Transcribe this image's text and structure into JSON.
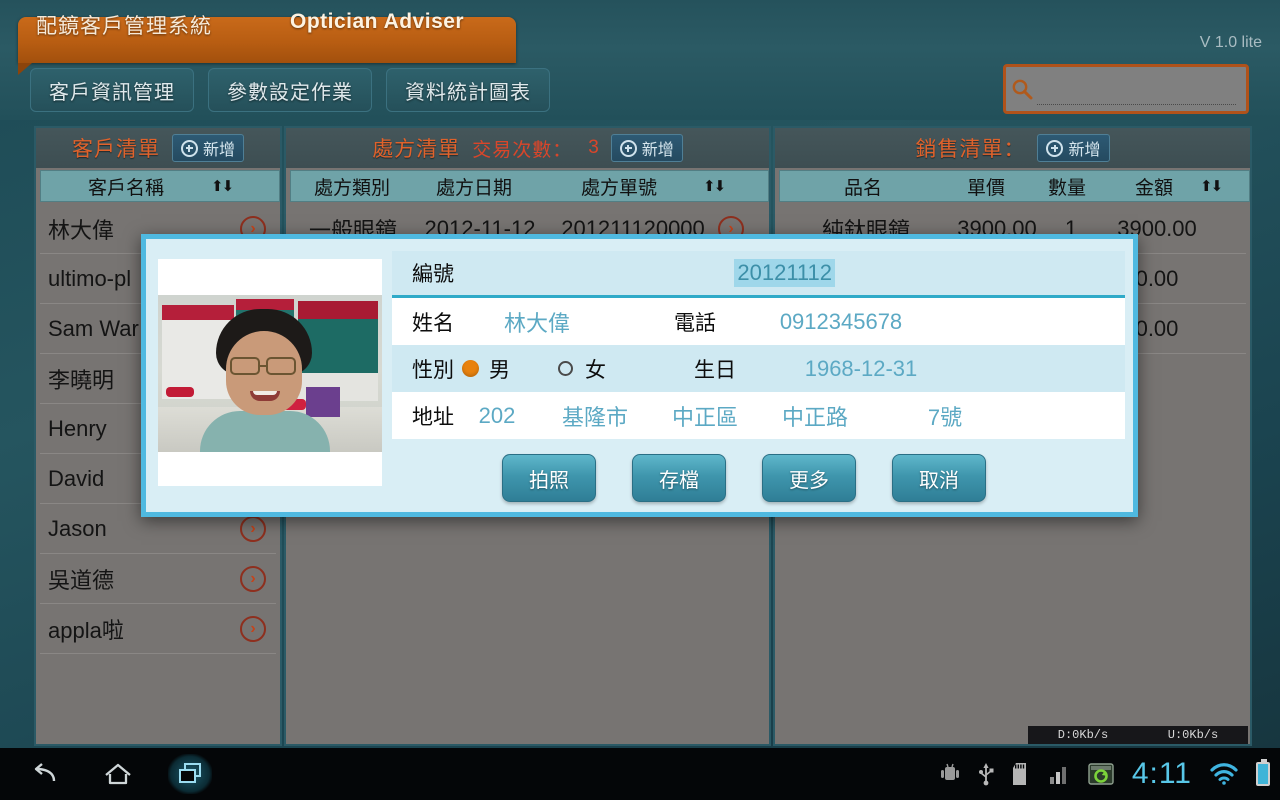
{
  "app": {
    "title_cn": "配鏡客戶管理系統",
    "title_en": "Optician Adviser",
    "version": "V 1.0 lite"
  },
  "tabs": [
    {
      "label": "客戶資訊管理"
    },
    {
      "label": "參數設定作業"
    },
    {
      "label": "資料統計圖表"
    }
  ],
  "search": {
    "value": "",
    "placeholder": "",
    "icon": "search-icon"
  },
  "customer_panel": {
    "title": "客戶清單",
    "add_label": "新增",
    "column": "客戶名稱",
    "sort_icon": "sort-updown-icon",
    "rows": [
      {
        "name": "林大偉"
      },
      {
        "name": "ultimo-pl"
      },
      {
        "name": "Sam War"
      },
      {
        "name": "李曉明"
      },
      {
        "name": "Henry"
      },
      {
        "name": "David"
      },
      {
        "name": "Jason"
      },
      {
        "name": "吳道德"
      },
      {
        "name": "appla啦"
      }
    ]
  },
  "prescription_panel": {
    "title": "處方清單",
    "trans_label": "交易次數：",
    "trans_count": "3",
    "add_label": "新增",
    "columns": [
      "處方類別",
      "處方日期",
      "處方單號"
    ],
    "sort_icon": "sort-updown-icon",
    "rows": [
      {
        "type": "一般眼鏡",
        "date": "2012-11-12",
        "no": "201211120000"
      }
    ]
  },
  "sales_panel": {
    "title": "銷售清單：",
    "add_label": "新增",
    "columns": [
      "品名",
      "單價",
      "數量",
      "金額"
    ],
    "sort_icon": "sort-updown-icon",
    "rows": [
      {
        "item": "純鈦眼鏡",
        "price": "3900.00",
        "qty": "1",
        "amount": "3900.00"
      },
      {
        "item": "",
        "price": "",
        "qty": "",
        "amount": "0.00"
      },
      {
        "item": "",
        "price": "",
        "qty": "",
        "amount": "0.00"
      }
    ]
  },
  "netspeed": {
    "down": "D:0Kb/s",
    "up": "U:0Kb/s"
  },
  "dialog": {
    "photo_alt": "customer-photo",
    "fields": {
      "id_label": "編號",
      "id_value": "20121112",
      "name_label": "姓名",
      "name_value": "林大偉",
      "phone_label": "電話",
      "phone_value": "0912345678",
      "gender_label": "性別",
      "gender_male": "男",
      "gender_female": "女",
      "birthday_label": "生日",
      "birthday_value": "1968-12-31",
      "address_label": "地址",
      "address_zip": "202",
      "address_city": "基隆市",
      "address_district": "中正區",
      "address_road": "中正路",
      "address_no": "7號"
    },
    "buttons": [
      {
        "label": "拍照",
        "name": "take-photo-button"
      },
      {
        "label": "存檔",
        "name": "save-button"
      },
      {
        "label": "更多",
        "name": "more-button"
      },
      {
        "label": "取消",
        "name": "cancel-button"
      }
    ]
  },
  "navbar": {
    "back": "back-icon",
    "home": "home-icon",
    "recents": "recent-apps-icon",
    "clock": "4:11",
    "status_icons": [
      "android-icon",
      "usb-icon",
      "sdcard-icon",
      "signal-icon",
      "sync-icon",
      "wifi-icon",
      "battery-icon"
    ]
  }
}
